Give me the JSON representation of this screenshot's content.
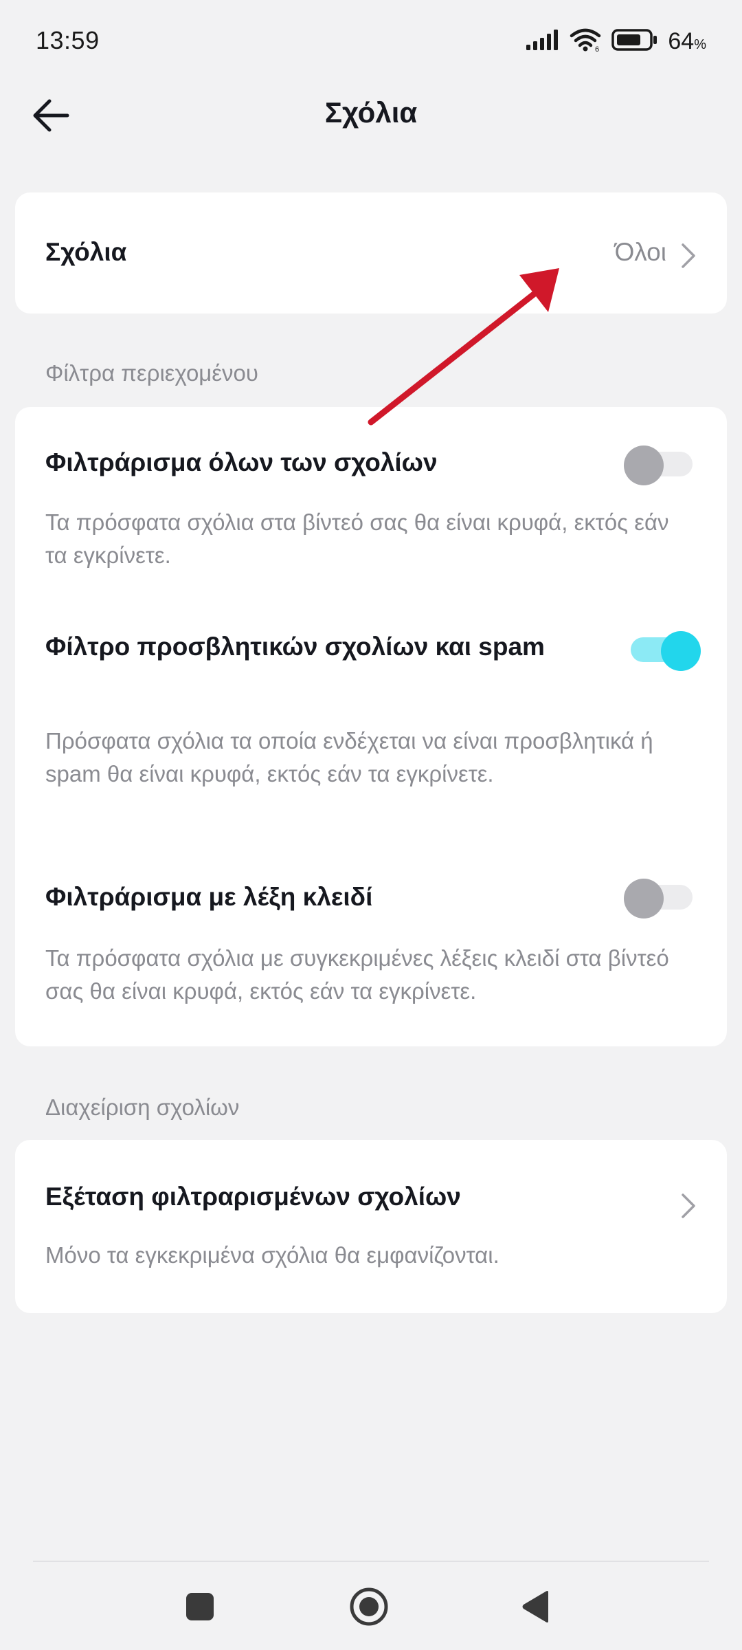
{
  "status_bar": {
    "time": "13:59",
    "battery_percent": "64",
    "battery_percent_symbol": "%",
    "icons": [
      "signal-icon",
      "wifi-icon",
      "battery-icon"
    ]
  },
  "header": {
    "title": "Σχόλια",
    "back_icon": "arrow-left-icon"
  },
  "comments_setting": {
    "label": "Σχόλια",
    "value": "Όλοι"
  },
  "content_filters": {
    "section_title": "Φίλτρα περιεχομένου",
    "items": [
      {
        "title": "Φιλτράρισμα όλων των σχολίων",
        "description": "Τα πρόσφατα σχόλια στα βίντεό σας θα είναι κρυφά, εκτός εάν τα εγκρίνετε.",
        "enabled": false
      },
      {
        "title": "Φίλτρο προσβλητικών σχολίων και spam",
        "description": "Πρόσφατα σχόλια τα οποία ενδέχεται να είναι προσβλητικά ή spam θα είναι κρυφά, εκτός εάν τα εγκρίνετε.",
        "enabled": true
      },
      {
        "title": "Φιλτράρισμα με λέξη κλειδί",
        "description": "Τα πρόσφατα σχόλια με συγκεκριμένες λέξεις κλειδί στα βίντεό σας θα είναι κρυφά, εκτός εάν τα εγκρίνετε.",
        "enabled": false
      }
    ]
  },
  "comment_management": {
    "section_title": "Διαχείριση σχολίων",
    "review_title": "Εξέταση φιλτραρισμένων σχολίων",
    "review_description": "Μόνο τα εγκεκριμένα σχόλια θα εμφανίζονται."
  },
  "colors": {
    "background": "#f2f2f3",
    "card": "#ffffff",
    "toggle_on": "#22d6ec",
    "toggle_off": "#a9a9ae",
    "annotation_arrow": "#d0182a"
  },
  "nav_bar": {
    "icons": [
      "square-recents-icon",
      "circle-home-icon",
      "triangle-back-icon"
    ]
  }
}
